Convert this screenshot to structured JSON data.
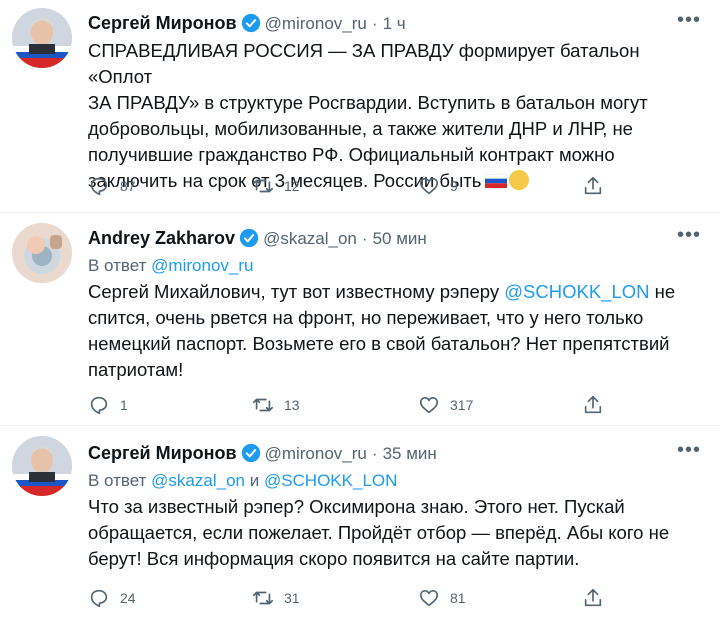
{
  "colors": {
    "accent": "#1d9bf0",
    "muted": "#536471",
    "text": "#0f1419"
  },
  "tweets": [
    {
      "author": "Сергей Миронов",
      "handle": "@mironov_ru",
      "dot": "·",
      "time": "1 ч",
      "reply_prefix": "",
      "reply_mention_1": "",
      "reply_joiner": "",
      "reply_mention_2": "",
      "text_lines": [
        "СПРАВЕДЛИВАЯ РОССИЯ — ЗА ПРАВДУ формирует батальон «Оплот",
        "ЗА ПРАВДУ» в структуре Росгвардии. Вступить в батальон могут",
        "добровольцы, мобилизованные, а также жители ДНР и ЛНР, не",
        "получившие гражданство РФ. Официальный контракт можно",
        "заключить на срок от 3 месяцев. России быть"
      ],
      "replies": "87",
      "retweets": "12",
      "likes": "9",
      "avatar_icon": "avatar-icon"
    },
    {
      "author": "Andrey Zakharov",
      "handle": "@skazal_on",
      "dot": "·",
      "time": "50 мин",
      "reply_prefix": "В ответ ",
      "reply_mention_1": "@mironov_ru",
      "reply_joiner": "",
      "reply_mention_2": "",
      "text_lines": [
        "Сергей Михайлович, тут вот известному рэперу ",
        "@SCHOKK_LON",
        " не",
        "спится, очень рвется на фронт, но переживает, что у него только",
        "немецкий паспорт. Возьмете его в свой батальон? Нет препятствий",
        "патриотам!"
      ],
      "replies": "1",
      "retweets": "13",
      "likes": "317",
      "avatar_icon": "avatar-icon"
    },
    {
      "author": "Сергей Миронов",
      "handle": "@mironov_ru",
      "dot": "·",
      "time": "35 мин",
      "reply_prefix": "В ответ ",
      "reply_mention_1": "@skazal_on",
      "reply_joiner": " и ",
      "reply_mention_2": "@SCHOKK_LON",
      "text_lines": [
        "Что за известный рэпер? Оксимирона знаю. Этого нет. Пускай",
        "обращается, если пожелает. Пройдёт отбор — вперёд. Абы кого не",
        "берут! Вся информация скоро появится на сайте партии."
      ],
      "replies": "24",
      "retweets": "31",
      "likes": "81",
      "avatar_icon": "avatar-icon"
    }
  ],
  "icons": {
    "more": "more-icon",
    "verified": "verified-badge-icon",
    "reply": "reply-icon",
    "retweet": "retweet-icon",
    "like": "like-icon",
    "share": "share-icon"
  }
}
